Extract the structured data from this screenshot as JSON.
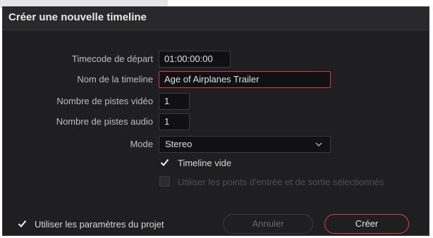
{
  "dialog": {
    "title": "Créer une nouvelle timeline"
  },
  "form": {
    "timecode_label": "Timecode de départ",
    "timecode_value": "01:00:00:00",
    "name_label": "Nom de la timeline",
    "name_value": "Age of Airplanes Trailer",
    "video_tracks_label": "Nombre de pistes vidéo",
    "video_tracks_value": "1",
    "audio_tracks_label": "Nombre de pistes audio",
    "audio_tracks_value": "1",
    "mode_label": "Mode",
    "mode_value": "Stereo",
    "empty_timeline_label": "Timeline vide",
    "empty_timeline_checked": true,
    "use_in_out_label": "Utiliser les points d'entrée et de sortie sélectionnés",
    "use_in_out_checked": false
  },
  "footer": {
    "use_project_settings_label": "Utiliser les paramètres du projet",
    "use_project_settings_checked": true,
    "cancel_label": "Annuler",
    "create_label": "Créer"
  },
  "colors": {
    "accent": "#c8443f",
    "background": "#1f1f21"
  }
}
